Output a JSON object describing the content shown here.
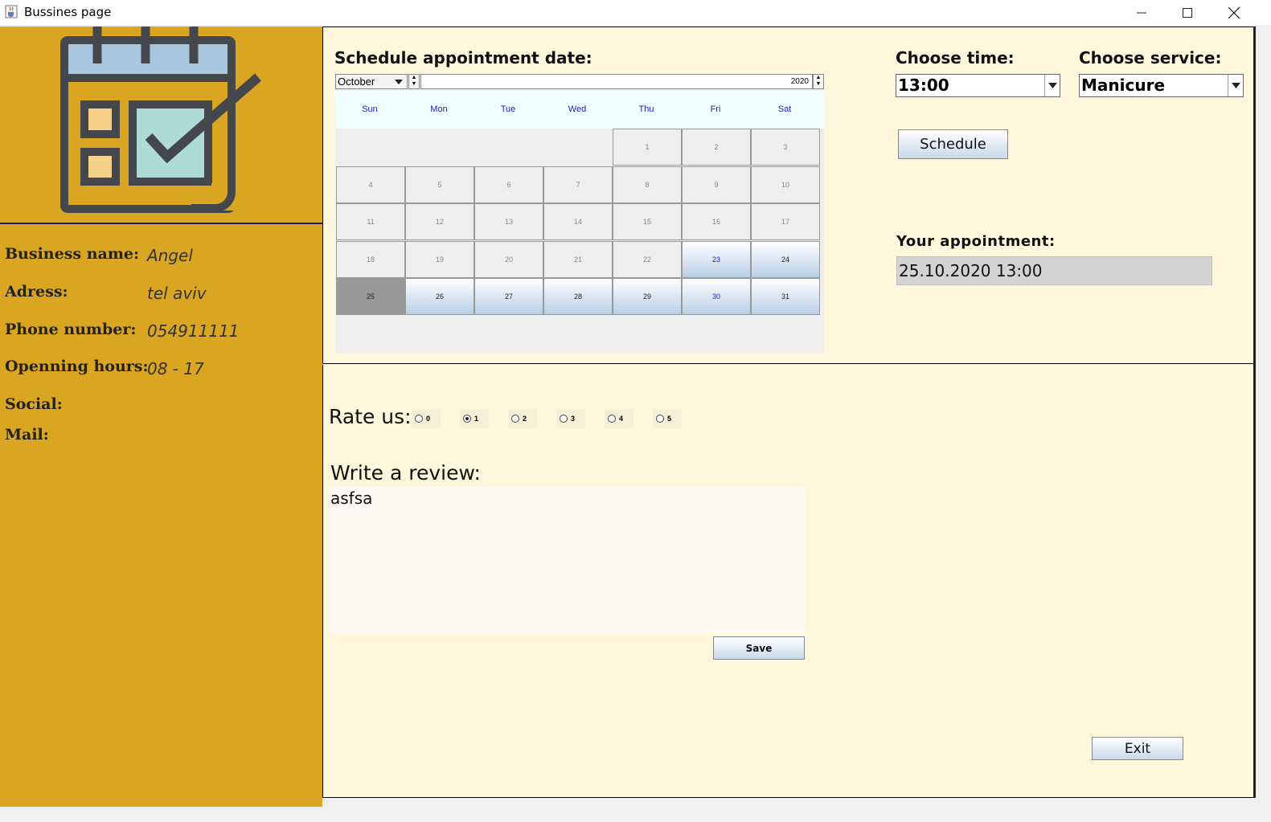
{
  "window": {
    "title": "Bussines page",
    "app_icon": "java-cup-icon",
    "controls": [
      "minimize-icon",
      "maximize-icon",
      "close-icon"
    ]
  },
  "sidebar": {
    "logo_icon": "calendar-check-icon",
    "colors": {
      "background": "#daa520"
    },
    "fields": [
      {
        "label": "Business name:",
        "value": "Angel"
      },
      {
        "label": "Adress:",
        "value": "tel aviv"
      },
      {
        "label": "Phone number:",
        "value": "054911111"
      },
      {
        "label": "Openning hours:",
        "value": "08 - 17"
      },
      {
        "label": "Social:",
        "value": ""
      },
      {
        "label": "Mail:",
        "value": ""
      }
    ]
  },
  "schedule": {
    "heading": "Schedule appointment date:",
    "calendar": {
      "month": "October",
      "year": "2020",
      "weekdays": [
        "Sun",
        "Mon",
        "Tue",
        "Wed",
        "Thu",
        "Fri",
        "Sat"
      ],
      "first_weekday_index": 4,
      "days_in_month": 31,
      "first_available_day": 23,
      "selected_day": "25"
    },
    "time_heading": "Choose time:",
    "time_value": "13:00",
    "service_heading": "Choose service:",
    "service_value": "Manicure",
    "schedule_button": "Schedule",
    "appointment_heading": "Your appointment:",
    "appointment_value": "25.10.2020 13:00"
  },
  "review": {
    "rate_label": "Rate us:",
    "rate_options": [
      "0",
      "1",
      "2",
      "3",
      "4",
      "5"
    ],
    "selected_rating": "1",
    "review_label": "Write a review:",
    "review_text": "asfsa",
    "save_button": "Save",
    "exit_button": "Exit"
  },
  "colors": {
    "panel_background": "#fff7dc",
    "accent_day": "#1a1acd"
  }
}
